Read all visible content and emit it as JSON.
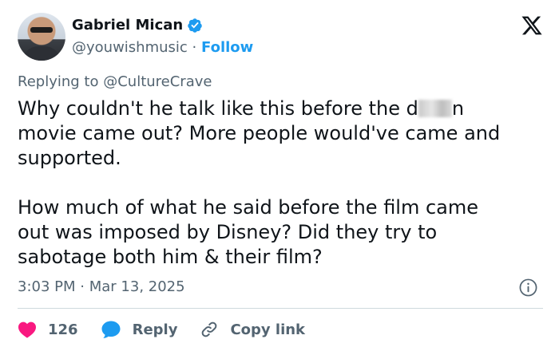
{
  "author": {
    "name": "Gabriel Mican",
    "handle": "@youwishmusic",
    "separator": "·",
    "follow_label": "Follow"
  },
  "reply_context": {
    "prefix": "Replying to",
    "mention": "@CultureCrave"
  },
  "tweet": {
    "line1_a": "Why couldn't he talk like this before the d",
    "line1_b": "n",
    "line2": "movie came out? More people would've came and",
    "line3": "supported.",
    "line4": "How much of what he said before the film came",
    "line5": "out was imposed by Disney? Did they try to",
    "line6": "sabotage both him & their film?"
  },
  "meta": {
    "time": "3:03 PM",
    "separator": "·",
    "date": "Mar 13, 2025"
  },
  "actions": {
    "like_count": "126",
    "reply_label": "Reply",
    "copy_label": "Copy link"
  },
  "colors": {
    "accent": "#1d9bf0",
    "like": "#f91880",
    "text": "#0f1419",
    "muted": "#536471"
  },
  "icons": [
    "verified-badge-icon",
    "x-logo-icon",
    "info-icon",
    "heart-icon",
    "reply-bubble-icon",
    "link-icon"
  ]
}
